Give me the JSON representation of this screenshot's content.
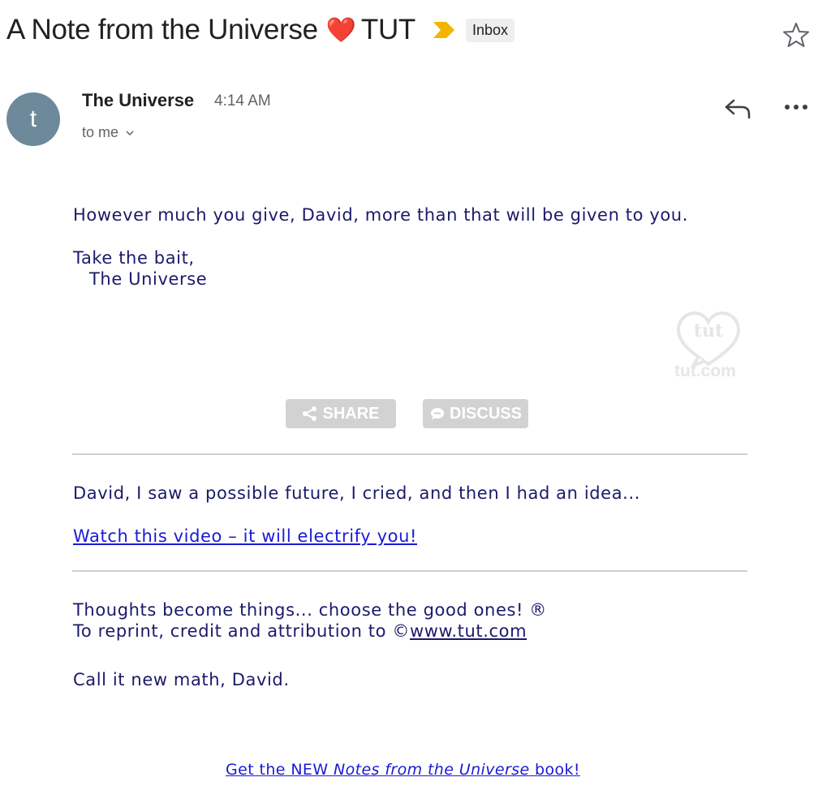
{
  "header": {
    "subject_prefix": "A Note from the Universe",
    "heart_glyph": "❤️",
    "subject_suffix": "TUT",
    "label_badge": "Inbox",
    "importance_color": "#f4b400"
  },
  "message": {
    "avatar_letter": "t",
    "avatar_color": "#6e8a9a",
    "sender": "The Universe",
    "time": "4:14 AM",
    "recipient": "to me"
  },
  "body": {
    "note": "However much you give, David, more than that will be given to you.",
    "signoff_line1": "Take the bait,",
    "signoff_line2": "The Universe",
    "logo_text": "tut",
    "logo_domain": "tut.com",
    "share_label": "SHARE",
    "discuss_label": "DISCUSS",
    "idea_text": "David, I saw a possible future, I cried, and then I had an idea...",
    "video_link": "Watch this video – it will electrify you!",
    "thoughts_text": "Thoughts become things... choose the good ones! ®",
    "reprint_prefix": "To reprint, credit and attribution to ©",
    "reprint_link": "www.tut.com",
    "closing": "Call it new math, David.",
    "book_link_prefix": "Get the NEW ",
    "book_link_title": "Notes from the Universe",
    "book_link_suffix": " book!"
  },
  "colors": {
    "body_text": "#1a1a6b",
    "link": "#1a1ad6",
    "button_bg": "#d2d2d2"
  }
}
